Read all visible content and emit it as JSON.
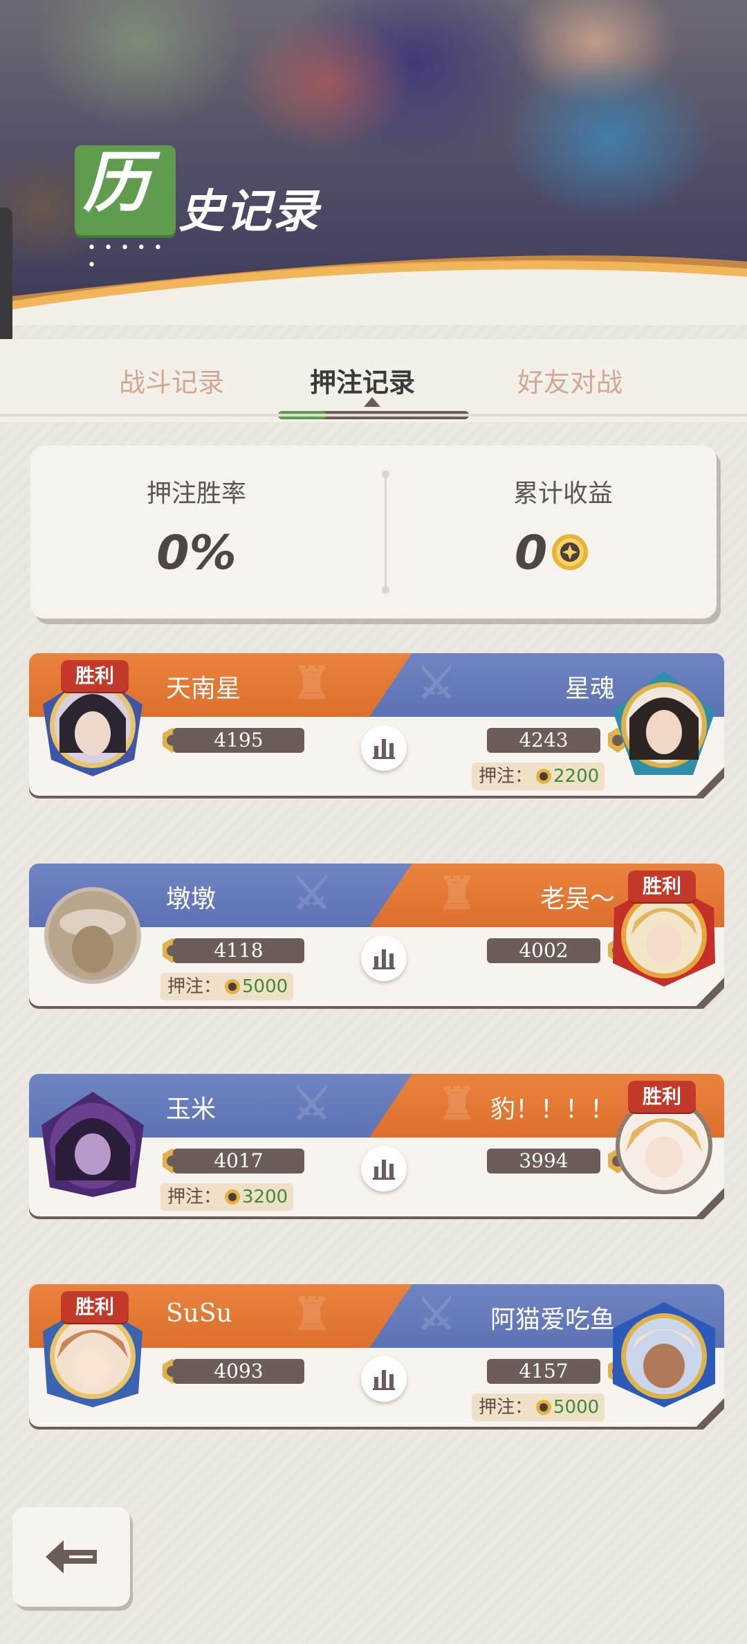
{
  "header": {
    "title_first_char": "历",
    "title_rest": "史记录"
  },
  "tabs": [
    {
      "label": "战斗记录",
      "active": false
    },
    {
      "label": "押注记录",
      "active": true
    },
    {
      "label": "好友对战",
      "active": false
    }
  ],
  "summary": {
    "win_rate_label": "押注胜率",
    "win_rate_value": "0%",
    "earnings_label": "累计收益",
    "earnings_value": "0"
  },
  "matches": [
    {
      "left": {
        "name": "天南星",
        "rating": "4195",
        "winner": true,
        "bet": null
      },
      "right": {
        "name": "星魂",
        "rating": "4243",
        "winner": false,
        "bet": "2200"
      }
    },
    {
      "left": {
        "name": "墩墩",
        "rating": "4118",
        "winner": false,
        "bet": "5000"
      },
      "right": {
        "name": "老吴～",
        "rating": "4002",
        "winner": true,
        "bet": null
      }
    },
    {
      "left": {
        "name": "玉米",
        "rating": "4017",
        "winner": false,
        "bet": "3200"
      },
      "right": {
        "name": "豹！！！！",
        "rating": "3994",
        "winner": true,
        "bet": null
      }
    },
    {
      "left": {
        "name": "SuSu",
        "rating": "4093",
        "winner": true,
        "bet": null
      },
      "right": {
        "name": "阿猫爱吃鱼",
        "rating": "4157",
        "winner": false,
        "bet": "5000"
      }
    }
  ],
  "labels": {
    "win_badge": "胜利",
    "bet_prefix": "押注："
  },
  "icons": {
    "coin": "coin-icon",
    "stats": "bar-chart-icon",
    "back": "back-arrow-icon",
    "rank": "rank-badge-icon"
  },
  "colors": {
    "brand_green": "#5f9c4e",
    "orange_side": "#e47a36",
    "blue_side": "#6579b9",
    "win_red": "#c33a2a",
    "bet_green": "#3f8a35"
  }
}
